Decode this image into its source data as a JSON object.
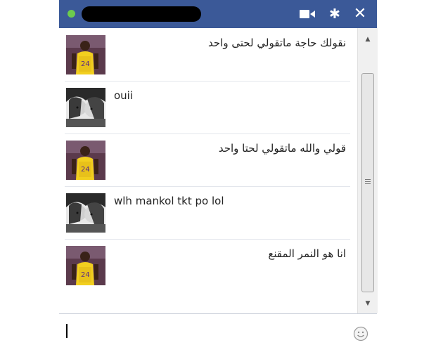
{
  "titlebar": {
    "presence": "online",
    "icons": [
      "video-icon",
      "gear-icon",
      "close-icon"
    ],
    "gear_glyph": "✱",
    "close_glyph": "✕",
    "color": "#3b5998"
  },
  "messages": [
    {
      "sender": "kobe-avatar",
      "text": "نقولك حاجة ماتقولي لحتى واحد",
      "dir": "rtl"
    },
    {
      "sender": "bw-avatar",
      "text": "ouii",
      "dir": "ltr"
    },
    {
      "sender": "kobe-avatar",
      "text": "قولي والله ماتقولي لحتا واحد",
      "dir": "rtl"
    },
    {
      "sender": "bw-avatar",
      "text": "wlh mankol tkt po lol",
      "dir": "ltr"
    },
    {
      "sender": "kobe-avatar",
      "text": "انا هو النمر المقنع",
      "dir": "rtl"
    }
  ],
  "scrollbar": {
    "up_glyph": "▲",
    "down_glyph": "▼"
  },
  "composer": {
    "value": "",
    "emoji_icon": "smiley-icon"
  }
}
